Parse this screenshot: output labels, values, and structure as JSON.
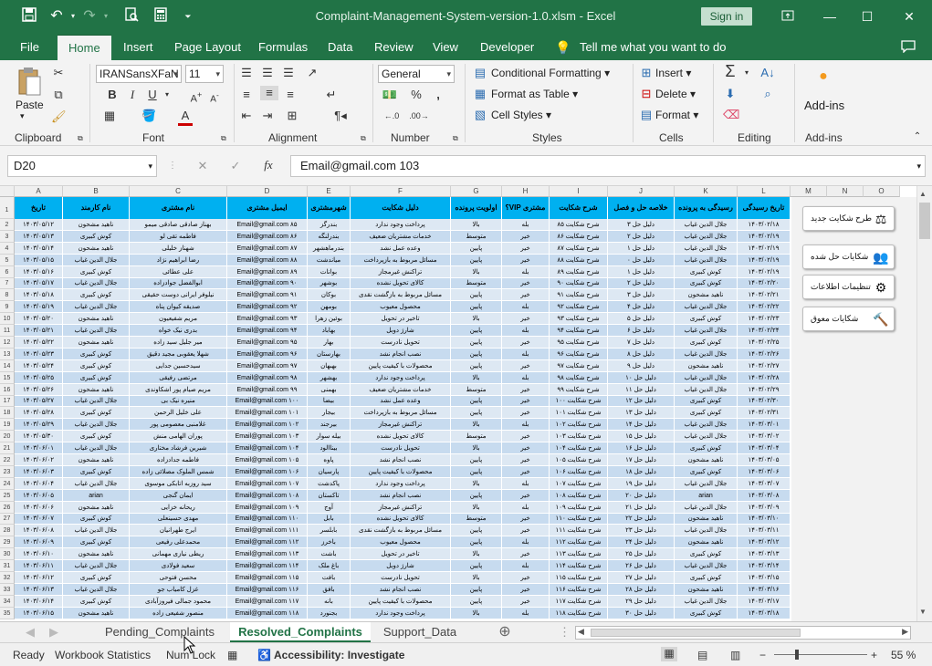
{
  "titlebar": {
    "title": "Complaint-Management-System-version-1.0.xlsm  -  Excel",
    "signin": "Sign in",
    "icons": [
      "save-icon",
      "undo-icon",
      "redo-icon",
      "print-preview-icon",
      "calculator-icon",
      "customize-icon"
    ]
  },
  "menu": [
    "File",
    "Home",
    "Insert",
    "Page Layout",
    "Formulas",
    "Data",
    "Review",
    "View",
    "Developer",
    "Tell me what you want to do"
  ],
  "ribbon": {
    "groups": [
      "Clipboard",
      "Font",
      "Alignment",
      "Number",
      "Styles",
      "Cells",
      "Editing",
      "Add-ins"
    ],
    "paste": "Paste",
    "font_name": "IRANSansXFaN",
    "font_size": "11",
    "number_format": "General",
    "cond_format": "Conditional Formatting",
    "format_table": "Format as Table",
    "cell_styles": "Cell Styles",
    "insert": "Insert",
    "delete": "Delete",
    "format": "Format",
    "addins": "Add-ins"
  },
  "formula": {
    "namebox": "D20",
    "content": "Email@gmail.com 103"
  },
  "columns": [
    "A",
    "B",
    "C",
    "D",
    "E",
    "F",
    "G",
    "H",
    "I",
    "J",
    "K",
    "L",
    "M",
    "N",
    "O"
  ],
  "headers": [
    "تاریخ",
    "نام کارمند",
    "نام مشتری",
    "ایمیل مشتری",
    "شهرمشتری",
    "دلیل شکایت",
    "اولویت پرونده",
    "مشتری VIP؟",
    "شرح شکایت",
    "خلاصه حل و فصل",
    "رسیدگی به پرونده",
    "تاریخ رسیدگی"
  ],
  "rows": [
    [
      "۱۴۰۳/۰۵/۱۲",
      "ناهید مشحون",
      "بهناز صادقی صادقی میمو",
      "Email@gmail.com ۸۵",
      "بندرگز",
      "پرداخت وجود ندارد",
      "بالا",
      "بله",
      "شرح شکایت ۸۵",
      "دلیل حل ۳",
      "جلال الدین غیاب",
      "۱۴۰۳/۰۲/۱۸"
    ],
    [
      "۱۴۰۳/۰۵/۱۳",
      "کوش کبیری",
      "فاطمه تقی لو",
      "Email@gmail.com ۸۶",
      "بندرلنگه",
      "خدمات مشتریان ضعیف",
      "متوسط",
      "خیر",
      "شرح شکایت ۸۶",
      "دلیل حل ۲",
      "جلال الدین غیاب",
      "۱۴۰۳/۰۲/۱۹"
    ],
    [
      "۱۴۰۳/۰۵/۱۴",
      "ناهید مشحون",
      "شهناز خلیلی",
      "Email@gmail.com ۸۷",
      "بندرماهشهر",
      "وعده عمل نشد",
      "پایین",
      "خیر",
      "شرح شکایت ۸۷",
      "دلیل حل ۱",
      "جلال الدین غیاب",
      "۱۴۰۳/۰۲/۱۹"
    ],
    [
      "۱۴۰۳/۰۵/۱۵",
      "جلال الدین غیاب",
      "رضا ابراهیم نژاد",
      "Email@gmail.com ۸۸",
      "میاندشت",
      "مسائل مربوط به بازپرداخت",
      "پایین",
      "خیر",
      "شرح شکایت ۸۸",
      "دلیل حل ۰",
      "جلال الدین غیاب",
      "۱۴۰۳/۰۲/۱۹"
    ],
    [
      "۱۴۰۳/۰۵/۱۶",
      "کوش کبیری",
      "علی عطائی",
      "Email@gmail.com ۸۹",
      "بوانات",
      "تراکنش غیرمجاز",
      "بالا",
      "بله",
      "شرح شکایت ۸۹",
      "دلیل حل ۱",
      "کوش کبیری",
      "۱۴۰۳/۰۲/۱۹"
    ],
    [
      "۱۴۰۳/۰۵/۱۷",
      "جلال الدین غیاب",
      "ابوالفضل جوادزاده",
      "Email@gmail.com ۹۰",
      "بوشهر",
      "کالای تحویل نشده",
      "متوسط",
      "خیر",
      "شرح شکایت ۹۰",
      "دلیل حل ۲",
      "کوش کبیری",
      "۱۴۰۳/۰۲/۲۰"
    ],
    [
      "۱۴۰۳/۰۵/۱۸",
      "کوش کبیری",
      "نیلوفر ایرانی دوست حقیقی",
      "Email@gmail.com ۹۱",
      "بوکان",
      "مسائل مربوط به بازگشت نقدی",
      "پایین",
      "خیر",
      "شرح شکایت ۹۱",
      "دلیل حل ۳",
      "ناهید مشحون",
      "۱۴۰۳/۰۲/۲۱"
    ],
    [
      "۱۴۰۳/۰۵/۱۹",
      "جلال الدین غیاب",
      "صدیقه کیوان پناه",
      "Email@gmail.com ۹۲",
      "بومهن",
      "محصول معیوب",
      "پایین",
      "بله",
      "شرح شکایت ۹۲",
      "دلیل حل ۴",
      "جلال الدین غیاب",
      "۱۴۰۳/۰۲/۲۲"
    ],
    [
      "۱۴۰۳/۰۵/۲۰",
      "ناهید مشحون",
      "مریم شفیعیون",
      "Email@gmail.com ۹۳",
      "بوئین زهرا",
      "تاخیر در تحویل",
      "بالا",
      "خیر",
      "شرح شکایت ۹۳",
      "دلیل حل ۵",
      "کوش کبیری",
      "۱۴۰۳/۰۲/۲۳"
    ],
    [
      "۱۴۰۳/۰۵/۲۱",
      "جلال الدین غیاب",
      "بدری نیک خواه",
      "Email@gmail.com ۹۴",
      "بهاباد",
      "شارژ دوبل",
      "پایین",
      "بله",
      "شرح شکایت ۹۴",
      "دلیل حل ۶",
      "جلال الدین غیاب",
      "۱۴۰۳/۰۲/۲۴"
    ],
    [
      "۱۴۰۳/۰۵/۲۲",
      "ناهید مشحون",
      "میر جلیل سید زاده",
      "Email@gmail.com ۹۵",
      "بهار",
      "تحویل نادرست",
      "پایین",
      "خیر",
      "شرح شکایت ۹۵",
      "دلیل حل ۷",
      "کوش کبیری",
      "۱۴۰۳/۰۲/۲۵"
    ],
    [
      "۱۴۰۳/۰۵/۲۳",
      "کوش کبیری",
      "شهلا یعقوبی مجید دقیق",
      "Email@gmail.com ۹۶",
      "بهارستان",
      "نصب انجام نشد",
      "پایین",
      "بله",
      "شرح شکایت ۹۶",
      "دلیل حل ۸",
      "جلال الدین غیاب",
      "۱۴۰۳/۰۲/۲۶"
    ],
    [
      "۱۴۰۳/۰۵/۲۴",
      "کوش کبیری",
      "سیدحسین جدایی",
      "Email@gmail.com ۹۷",
      "بهبهان",
      "محصولات با کیفیت پایین",
      "پایین",
      "خیر",
      "شرح شکایت ۹۷",
      "دلیل حل ۹",
      "ناهید مشحون",
      "۱۴۰۳/۰۲/۲۷"
    ],
    [
      "۱۴۰۳/۰۵/۲۵",
      "کوش کبیری",
      "مرتضی رفیقی",
      "Email@gmail.com ۹۸",
      "بهشهر",
      "پرداخت وجود ندارد",
      "بالا",
      "بله",
      "شرح شکایت ۹۸",
      "دلیل حل ۱۰",
      "جلال الدین غیاب",
      "۱۴۰۳/۰۲/۲۸"
    ],
    [
      "۱۴۰۳/۰۵/۲۶",
      "ناهید مشحون",
      "مریم صیام پور اشکاوندی",
      "Email@gmail.com ۹۹",
      "بهمنی",
      "خدمات مشتریان ضعیف",
      "متوسط",
      "خیر",
      "شرح شکایت ۹۹",
      "دلیل حل ۱۱",
      "جلال الدین غیاب",
      "۱۴۰۳/۰۲/۲۹"
    ],
    [
      "۱۴۰۳/۰۵/۲۷",
      "جلال الدین غیاب",
      "منیره نیک بی",
      "Email@gmail.com ۱۰۰",
      "بیضا",
      "وعده عمل نشد",
      "پایین",
      "خیر",
      "شرح شکایت ۱۰۰",
      "دلیل حل ۱۲",
      "کوش کبیری",
      "۱۴۰۳/۰۲/۳۰"
    ],
    [
      "۱۴۰۳/۰۵/۲۸",
      "کوش کبیری",
      "علی خلیل الرحمن",
      "Email@gmail.com ۱۰۱",
      "بیجار",
      "مسائل مربوط به بازپرداخت",
      "پایین",
      "خیر",
      "شرح شکایت ۱۰۱",
      "دلیل حل ۱۳",
      "کوش کبیری",
      "۱۴۰۳/۰۲/۳۱"
    ],
    [
      "۱۴۰۳/۰۵/۲۹",
      "جلال الدین غیاب",
      "غلامنبی معصومی پور",
      "Email@gmail.com ۱۰۲",
      "بیرجند",
      "تراکنش غیرمجاز",
      "بالا",
      "بله",
      "شرح شکایت ۱۰۲",
      "دلیل حل ۱۴",
      "جلال الدین غیاب",
      "۱۴۰۳/۰۳/۰۱"
    ],
    [
      "۱۴۰۳/۰۵/۳۰",
      "کوش کبیری",
      "پوران الهامی منش",
      "Email@gmail.com ۱۰۳",
      "بیله سوار",
      "کالای تحویل نشده",
      "متوسط",
      "خیر",
      "شرح شکایت ۱۰۳",
      "دلیل حل ۱۵",
      "جلال الدین غیاب",
      "۱۴۰۳/۰۳/۰۲"
    ],
    [
      "۱۴۰۳/۰۶/۰۱",
      "جلال الدین غیاب",
      "شیرین فرشاد مختاری",
      "Email@gmail.com ۱۰۴",
      "بیناالود",
      "تحویل نادرست",
      "بالا",
      "خیر",
      "شرح شکایت ۱۰۴",
      "دلیل حل ۱۶",
      "کوش کبیری",
      "۱۴۰۳/۰۳/۰۴"
    ],
    [
      "۱۴۰۳/۰۶/۰۲",
      "ناهید مشحون",
      "فاطمه جدادزاده",
      "Email@gmail.com ۱۰۵",
      "پاوه",
      "نصب انجام نشد",
      "پایین",
      "خیر",
      "شرح شکایت ۱۰۵",
      "دلیل حل ۱۷",
      "ناهید مشحون",
      "۱۴۰۳/۰۳/۰۵"
    ],
    [
      "۱۴۰۳/۰۶/۰۳",
      "کوش کبیری",
      "شمس الملوک مصلائی زاده",
      "Email@gmail.com ۱۰۶",
      "پارسیان",
      "محصولات با کیفیت پایین",
      "پایین",
      "خیر",
      "شرح شکایت ۱۰۶",
      "دلیل حل ۱۸",
      "کوش کبیری",
      "۱۴۰۳/۰۳/۰۶"
    ],
    [
      "۱۴۰۳/۰۶/۰۴",
      "جلال الدین غیاب",
      "سید روزبه اتابکی موسوی",
      "Email@gmail.com ۱۰۷",
      "پاکدشت",
      "پرداخت وجود ندارد",
      "بالا",
      "بله",
      "شرح شکایت ۱۰۷",
      "دلیل حل ۱۹",
      "جلال الدین غیاب",
      "۱۴۰۳/۰۳/۰۷"
    ],
    [
      "۱۴۰۳/۰۶/۰۵",
      "arian",
      "ایمان گنجی",
      "Email@gmail.com ۱۰۸",
      "تاکستان",
      "نصب انجام نشد",
      "پایین",
      "خیر",
      "شرح شکایت ۱۰۸",
      "دلیل حل ۲۰",
      "arian",
      "۱۴۰۳/۰۳/۰۸"
    ],
    [
      "۱۴۰۳/۰۶/۰۶",
      "ناهید مشحون",
      "ریحانه خزایی",
      "Email@gmail.com ۱۰۹",
      "آوج",
      "تراکنش غیرمجاز",
      "بالا",
      "بله",
      "شرح شکایت ۱۰۹",
      "دلیل حل ۲۱",
      "جلال الدین غیاب",
      "۱۴۰۳/۰۳/۰۹"
    ],
    [
      "۱۴۰۳/۰۶/۰۷",
      "کوش کبیری",
      "مهدی حسینعلی",
      "Email@gmail.com ۱۱۰",
      "بابل",
      "کالای تحویل نشده",
      "متوسط",
      "خیر",
      "شرح شکایت ۱۱۰",
      "دلیل حل ۲۲",
      "ناهید مشحون",
      "۱۴۰۳/۰۳/۱۰"
    ],
    [
      "۱۴۰۳/۰۶/۰۸",
      "جلال الدین غیاب",
      "ایرج طهرانیان",
      "Email@gmail.com ۱۱۱",
      "بابلسر",
      "مسائل مربوط به بازگشت نقدی",
      "پایین",
      "خیر",
      "شرح شکایت ۱۱۱",
      "دلیل حل ۲۳",
      "جلال الدین غیاب",
      "۱۴۰۳/۰۳/۱۱"
    ],
    [
      "۱۴۰۳/۰۶/۰۹",
      "کوش کبیری",
      "محمدعلی رفیعی",
      "Email@gmail.com ۱۱۲",
      "باخرز",
      "محصول معیوب",
      "پایین",
      "بله",
      "شرح شکایت ۱۱۲",
      "دلیل حل ۲۴",
      "ناهید مشحون",
      "۱۴۰۳/۰۳/۱۲"
    ],
    [
      "۱۴۰۳/۰۶/۱۰",
      "ناهید مشحون",
      "ریطی نیازی مهمانی",
      "Email@gmail.com ۱۱۳",
      "باشت",
      "تاخیر در تحویل",
      "بالا",
      "خیر",
      "شرح شکایت ۱۱۳",
      "دلیل حل ۲۵",
      "کوش کبیری",
      "۱۴۰۳/۰۳/۱۳"
    ],
    [
      "۱۴۰۳/۰۶/۱۱",
      "جلال الدین غیاب",
      "سعید فولادی",
      "Email@gmail.com ۱۱۴",
      "باغ ملک",
      "شارژ دوبل",
      "پایین",
      "بله",
      "شرح شکایت ۱۱۴",
      "دلیل حل ۲۶",
      "جلال الدین غیاب",
      "۱۴۰۳/۰۳/۱۴"
    ],
    [
      "۱۴۰۳/۰۶/۱۲",
      "کوش کبیری",
      "محسن فتوحی",
      "Email@gmail.com ۱۱۵",
      "بافت",
      "تحویل نادرست",
      "بالا",
      "خیر",
      "شرح شکایت ۱۱۵",
      "دلیل حل ۲۷",
      "کوش کبیری",
      "۱۴۰۳/۰۳/۱۵"
    ],
    [
      "۱۴۰۳/۰۶/۱۳",
      "جلال الدین غیاب",
      "غزل کامیاب جو",
      "Email@gmail.com ۱۱۶",
      "بافق",
      "نصب انجام نشد",
      "پایین",
      "خیر",
      "شرح شکایت ۱۱۶",
      "دلیل حل ۲۸",
      "ناهید مشحون",
      "۱۴۰۳/۰۳/۱۶"
    ],
    [
      "۱۴۰۳/۰۶/۱۴",
      "کوش کبیری",
      "محمود جمالی فیروزآبادی",
      "Email@gmail.com ۱۱۷",
      "بانه",
      "محصولات با کیفیت پایین",
      "پایین",
      "خیر",
      "شرح شکایت ۱۱۷",
      "دلیل حل ۲۹",
      "جلال الدین غیاب",
      "۱۴۰۳/۰۳/۱۷"
    ],
    [
      "۱۴۰۳/۰۶/۱۵",
      "ناهید مشحون",
      "منصور شفیعی زاده",
      "Email@gmail.com ۱۱۸",
      "بجنورد",
      "پرداخت وجود ندارد",
      "بالا",
      "بله",
      "شرح شکایت ۱۱۸",
      "دلیل حل ۳۰",
      "کوش کبیری",
      "۱۴۰۳/۰۳/۱۸"
    ]
  ],
  "buttons": [
    {
      "label": "طرح شکایت جدید",
      "icon": "scale-icon"
    },
    {
      "label": "شکایات حل شده",
      "icon": "users-icon"
    },
    {
      "label": "تنظیمات اطلاعات",
      "icon": "head-gear-icon"
    },
    {
      "label": "شکایات معوق",
      "icon": "gavel-icon"
    }
  ],
  "sheets": [
    "Pending_Complaints",
    "Resolved_Complaints",
    "Support_Data"
  ],
  "active_sheet": "Resolved_Complaints",
  "status": {
    "ready": "Ready",
    "stats": "Workbook Statistics",
    "numlock": "Num Lock",
    "accessibility": "Accessibility: Investigate",
    "zoom": "55 %"
  },
  "colors": {
    "header": "#00b0f0",
    "row_even": "#dde8f3",
    "row_odd": "#c7dbef",
    "accent": "#217346"
  }
}
